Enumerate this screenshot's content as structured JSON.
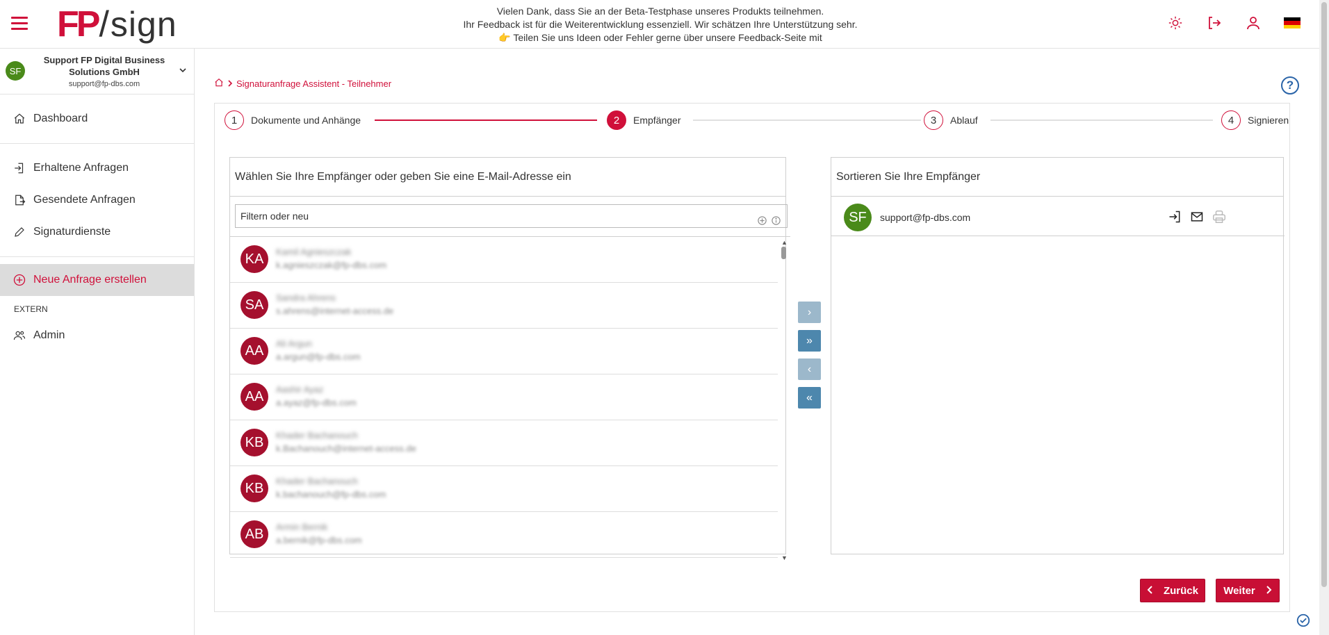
{
  "header": {
    "logo_fp": "FP",
    "logo_slash": "/",
    "logo_sign": "sign",
    "beta_line1": "Vielen Dank, dass Sie an der Beta-Testphase unseres Produkts teilnehmen.",
    "beta_line2": "Ihr Feedback ist für die Weiterentwicklung essenziell. Wir schätzen Ihre Unterstützung sehr.",
    "beta_line3": "👉 Teilen Sie uns Ideen oder Fehler gerne über unsere Feedback-Seite mit",
    "icons": [
      "sun-icon",
      "logout-icon",
      "user-icon",
      "flag-de-icon"
    ]
  },
  "sidebar": {
    "user": {
      "initials": "SF",
      "name": "Support FP Digital Business Solutions GmbH",
      "email": "support@fp-dbs.com"
    },
    "items": [
      {
        "label": "Dashboard",
        "icon": "home-icon"
      },
      {
        "label": "Erhaltene Anfragen",
        "icon": "inbox-icon"
      },
      {
        "label": "Gesendete Anfragen",
        "icon": "sent-icon"
      },
      {
        "label": "Signaturdienste",
        "icon": "pen-icon"
      },
      {
        "label": "Neue Anfrage erstellen",
        "icon": "plus-circle-icon",
        "active": true
      }
    ],
    "section_extern": "EXTERN",
    "admin_label": "Admin"
  },
  "breadcrumb": {
    "label": "Signaturanfrage Assistent - Teilnehmer"
  },
  "stepper": {
    "steps": [
      {
        "num": "1",
        "label": "Dokumente und Anhänge"
      },
      {
        "num": "2",
        "label": "Empfänger"
      },
      {
        "num": "3",
        "label": "Ablauf"
      },
      {
        "num": "4",
        "label": "Signieren"
      }
    ],
    "active_step": 2
  },
  "left_panel": {
    "title": "Wählen Sie Ihre Empfänger oder geben Sie eine E-Mail-Adresse ein",
    "filter_placeholder": "Filtern oder neu",
    "contacts": [
      {
        "initials": "KA",
        "name": "Kamil Agnieszczak",
        "email": "k.agnieszczak@fp-dbs.com"
      },
      {
        "initials": "SA",
        "name": "Sandra Ahrens",
        "email": "s.ahrens@internet-access.de"
      },
      {
        "initials": "AA",
        "name": "Ali Argun",
        "email": "a.argun@fp-dbs.com"
      },
      {
        "initials": "AA",
        "name": "Aashir Ayaz",
        "email": "a.ayaz@fp-dbs.com"
      },
      {
        "initials": "KB",
        "name": "Khader Bachanouch",
        "email": "k.Bachanouch@internet-access.de"
      },
      {
        "initials": "KB",
        "name": "Khader Bachanouch",
        "email": "k.bachanouch@fp-dbs.com"
      },
      {
        "initials": "AB",
        "name": "Armin Bernik",
        "email": "a.bernik@fp-dbs.com"
      }
    ]
  },
  "transfer_buttons": [
    {
      "glyph": "›",
      "state": "disabled"
    },
    {
      "glyph": "»",
      "state": "enabled"
    },
    {
      "glyph": "‹",
      "state": "disabled"
    },
    {
      "glyph": "«",
      "state": "enabled"
    }
  ],
  "right_panel": {
    "title": "Sortieren Sie Ihre Empfänger",
    "selected": [
      {
        "initials": "SF",
        "email": "support@fp-dbs.com"
      }
    ]
  },
  "actions": {
    "back_label": "Zurück",
    "next_label": "Weiter"
  }
}
